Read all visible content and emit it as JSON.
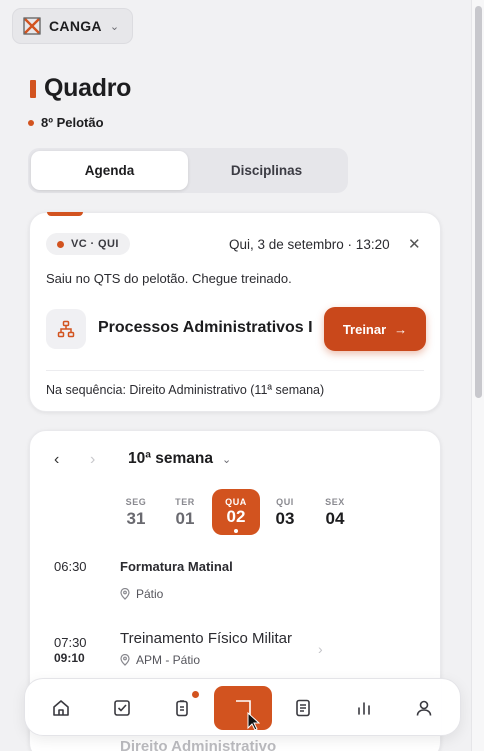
{
  "app": {
    "name": "CANGA"
  },
  "page": {
    "title": "Quadro",
    "subtitle": "8º Pelotão"
  },
  "segmented": {
    "items": [
      "Agenda",
      "Disciplinas"
    ],
    "active": "Agenda"
  },
  "alert": {
    "badge": "VC · QUI",
    "date": "Qui, 3 de setembro · 13:20",
    "message": "Saiu no QTS do pelotão. Chegue treinado.",
    "course": "Processos Administrativos I",
    "action_label": "Treinar",
    "next": "Na sequência: Direito Administrativo (11ª semana)"
  },
  "week": {
    "label": "10ª semana",
    "days": [
      {
        "name": "SEG",
        "date": "31"
      },
      {
        "name": "TER",
        "date": "01"
      },
      {
        "name": "QUA",
        "date": "02"
      },
      {
        "name": "QUI",
        "date": "03"
      },
      {
        "name": "SEX",
        "date": "04"
      }
    ],
    "selected_day": "QUA"
  },
  "events": [
    {
      "time": "06:30",
      "title": "Formatura Matinal",
      "location": "Pátio"
    },
    {
      "time_start": "07:30",
      "time_end": "09:10",
      "title": "Treinamento Físico Militar",
      "location": "APM - Pátio"
    }
  ],
  "faded_next": "Direito Administrativo",
  "nav": {
    "items": [
      "home-icon",
      "checklist-icon",
      "clipboard-icon",
      "board-icon",
      "document-icon",
      "chart-icon",
      "user-icon"
    ],
    "active": "board-icon"
  },
  "colors": {
    "accent": "#d2531f",
    "button": "#c9481b",
    "background": "#f1f1f3"
  }
}
